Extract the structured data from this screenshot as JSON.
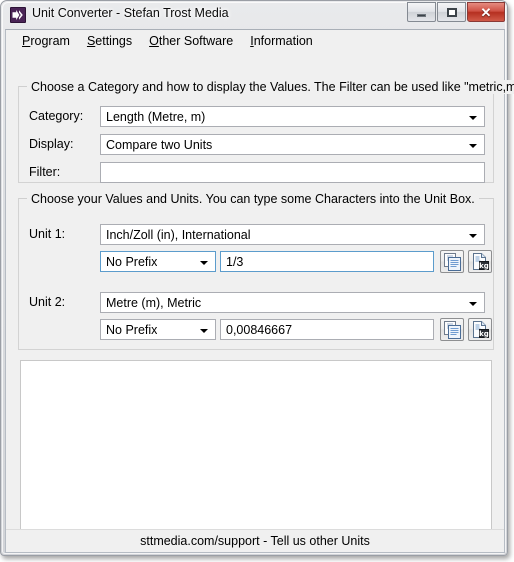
{
  "window": {
    "title": "Unit Converter - Stefan Trost Media",
    "app_icon": "double-arrow-icon",
    "controls": {
      "minimize": "minimize-icon",
      "maximize": "maximize-icon",
      "close": "close-icon",
      "close_glyph": "✕"
    }
  },
  "menu": [
    {
      "label": "Program",
      "accelerator": "P",
      "rest": "rogram"
    },
    {
      "label": "Settings",
      "accelerator": "S",
      "rest": "ettings"
    },
    {
      "label": "Other Software",
      "accelerator": "O",
      "rest": "ther Software"
    },
    {
      "label": "Information",
      "accelerator": "I",
      "rest": "nformation"
    }
  ],
  "group_category": {
    "title": "Choose a Category and how to display the Values. The Filter can be used like \"metric,mile\".",
    "category_label": "Category:",
    "category_value": "Length (Metre, m)",
    "display_label": "Display:",
    "display_value": "Compare two Units",
    "filter_label": "Filter:",
    "filter_value": "",
    "filter_placeholder": ""
  },
  "group_units": {
    "title": "Choose your Values and Units. You can type some Characters into the Unit Box.",
    "unit1": {
      "label": "Unit 1:",
      "unit_value": "Inch/Zoll (in), International",
      "prefix_value": "No Prefix",
      "amount_value": "1/3",
      "copy_button": "copy-icon",
      "kg_button": "kg-unit-icon"
    },
    "unit2": {
      "label": "Unit 2:",
      "unit_value": "Metre (m), Metric",
      "prefix_value": "No Prefix",
      "amount_value": "0,00846667",
      "copy_button": "copy-icon",
      "kg_button": "kg-unit-icon"
    }
  },
  "output": {
    "text": ""
  },
  "statusbar": {
    "text": "sttmedia.com/support - Tell us other Units"
  },
  "colors": {
    "close_button": "#b52f20",
    "accent_focus": "#5c9ccc",
    "client_background": "#f0f0f0",
    "icon_blue": "#5a8ac6"
  }
}
